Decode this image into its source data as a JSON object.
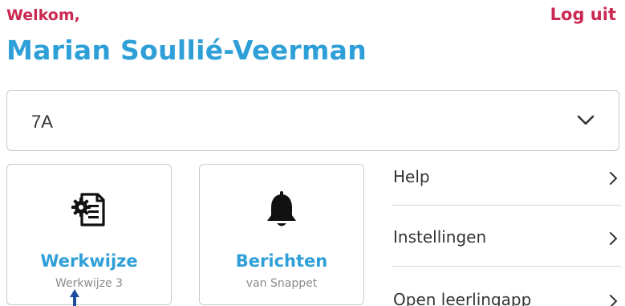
{
  "header": {
    "welcome": "Welkom,",
    "user_name": "Marian Soullié-Veerman",
    "logout_label": "Log uit"
  },
  "class_selector": {
    "value": "7A",
    "icon": "chevron-down-icon"
  },
  "tiles": [
    {
      "title": "Werkwijze",
      "subtitle": "Werkwijze 3",
      "icon": "document-settings-icon"
    },
    {
      "title": "Berichten",
      "subtitle": "van Snappet",
      "icon": "bell-icon"
    }
  ],
  "menu": {
    "items": [
      {
        "label": "Help"
      },
      {
        "label": "Instellingen"
      },
      {
        "label": "Open leerlingapp"
      }
    ]
  },
  "colors": {
    "accent_red": "#cc2952",
    "accent_blue": "#2f9fd8",
    "text": "#333333",
    "border": "#c9c9c9"
  }
}
